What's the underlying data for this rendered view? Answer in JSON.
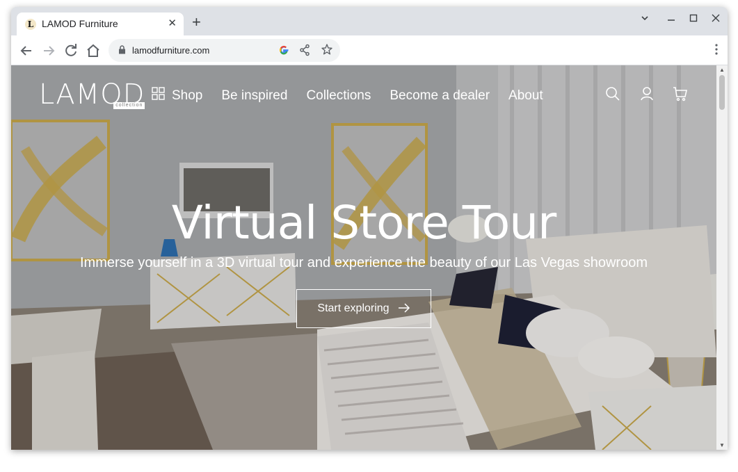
{
  "browser": {
    "tab_title": "LAMOD Furniture",
    "favicon_letter": "L",
    "url": "lamodfurniture.com"
  },
  "site": {
    "logo_text": "LAMOD",
    "logo_subtext": "collection",
    "nav": [
      {
        "label": "Shop",
        "icon": "grid-icon"
      },
      {
        "label": "Be inspired"
      },
      {
        "label": "Collections"
      },
      {
        "label": "Become a dealer"
      },
      {
        "label": "About"
      }
    ],
    "icons": [
      "search-icon",
      "account-icon",
      "cart-icon"
    ]
  },
  "hero": {
    "title": "Virtual Store Tour",
    "subtitle": "Immerse yourself in a 3D virtual tour and experience the beauty of our Las Vegas showroom",
    "cta_label": "Start exploring"
  },
  "colors": {
    "accent_gold": "#c9a94c",
    "overlay_text": "#ffffff"
  }
}
